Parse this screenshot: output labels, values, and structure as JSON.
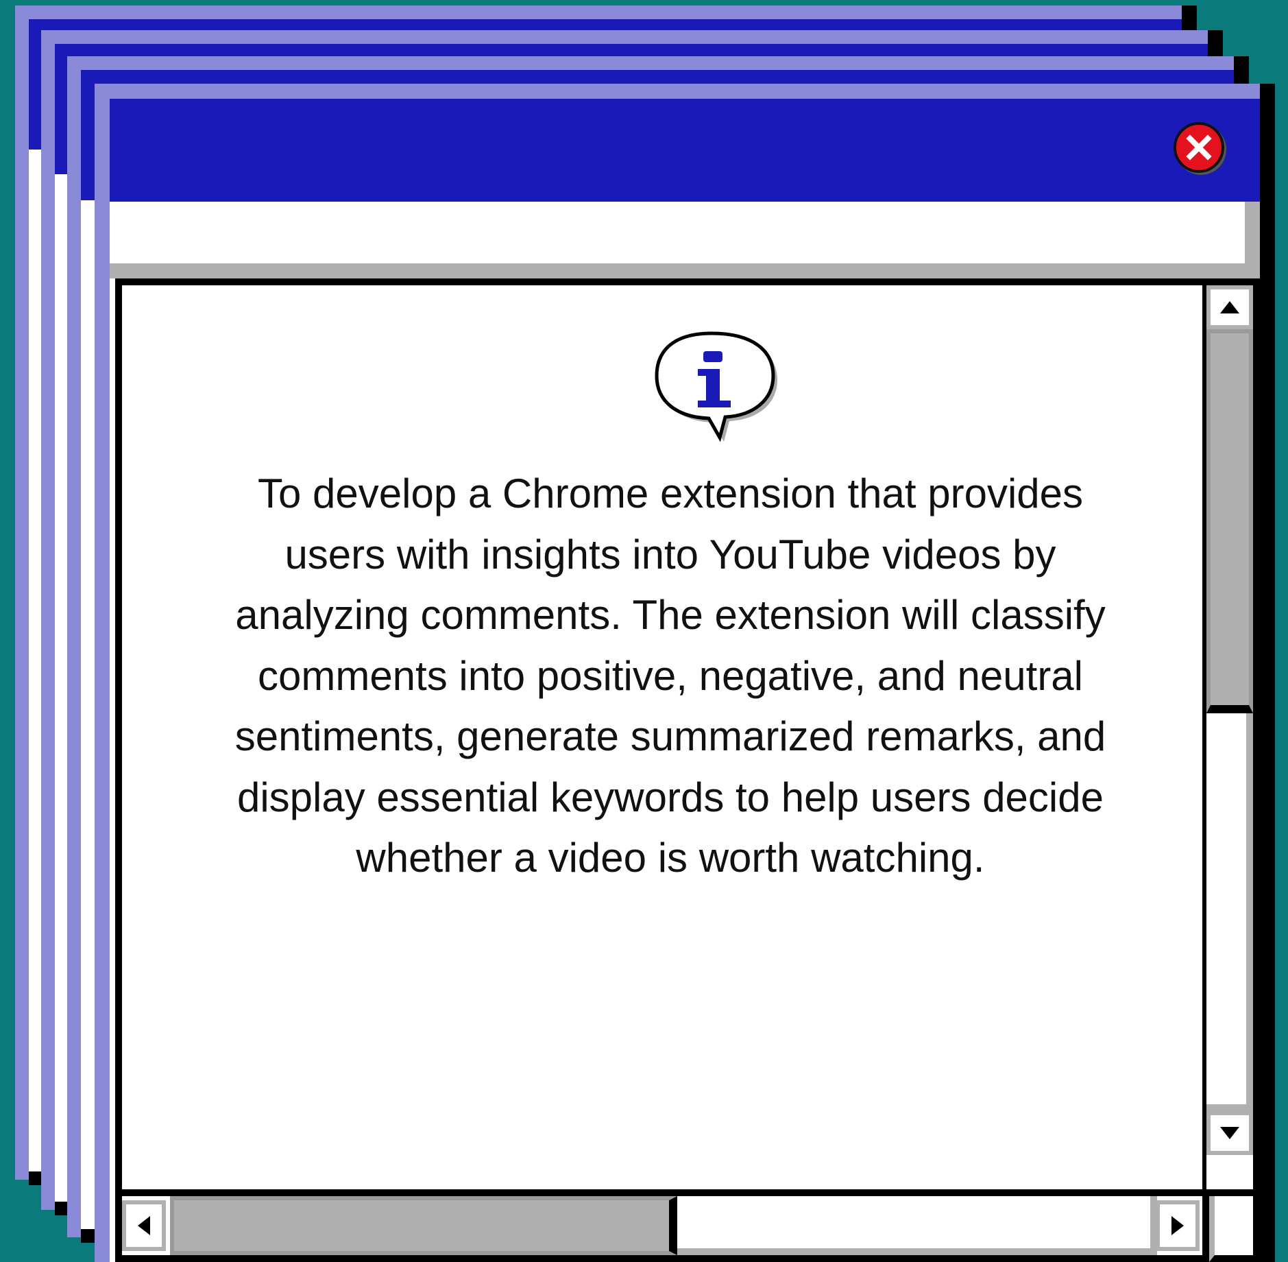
{
  "dialog": {
    "message": "To develop a Chrome extension that provides users with insights into YouTube videos by analyzing comments. The extension will classify comments into positive, negative, and neutral sentiments, generate summarized remarks, and display essential keywords to help users decide whether a video is worth watching.",
    "icon": "info-icon",
    "close_icon": "close-icon"
  },
  "scrollbars": {
    "vertical_thumb_fraction": 0.45,
    "horizontal_thumb_fraction": 0.5
  },
  "colors": {
    "desktop": "#0b7a7a",
    "titlebar": "#1a1ab8",
    "titlebar_highlight": "#8a8ad8",
    "close_button": "#e4121e",
    "scrollbar": "#b0b0b0"
  }
}
